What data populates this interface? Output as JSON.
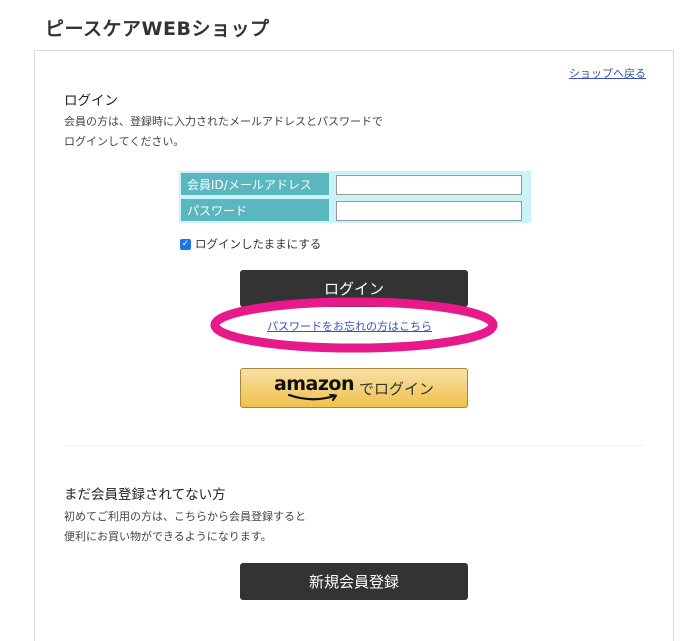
{
  "header": {
    "shop_title": "ピースケアWEBショップ"
  },
  "nav": {
    "back_to_shop": "ショップへ戻る"
  },
  "login": {
    "heading": "ログイン",
    "description_line1": "会員の方は、登録時に入力されたメールアドレスとパスワードで",
    "description_line2": "ログインしてください。",
    "id_label": "会員ID/メールアドレス",
    "id_value": "",
    "password_label": "パスワード",
    "password_value": "",
    "keep_logged_in_label": "ログインしたままにする",
    "keep_logged_in_checked": true,
    "login_button": "ログイン",
    "forgot_password_link": "パスワードをお忘れの方はこちら",
    "amazon_logo_text": "amazon",
    "amazon_login_label": "でログイン"
  },
  "register": {
    "heading": "まだ会員登録されてない方",
    "description_line1": "初めてご利用の方は、こちらから会員登録すると",
    "description_line2": "便利にお買い物ができるようになります。",
    "register_button": "新規会員登録"
  },
  "colors": {
    "label_cell_bg": "#5ab7bf",
    "table_bg": "#c9f3f8",
    "dark_button_bg": "#333333",
    "amazon_button_bg": "#f0c14b",
    "highlight_ellipse": "#e8198b",
    "link": "#3b4fb8"
  },
  "icons": {
    "checkbox": "checkmark-icon",
    "amazon_smile": "amazon-smile-icon"
  }
}
